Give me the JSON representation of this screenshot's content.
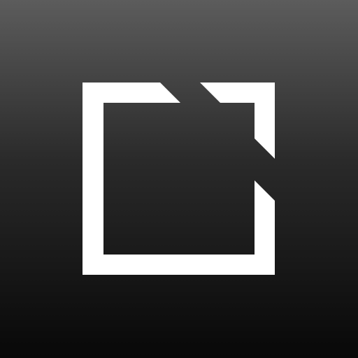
{
  "app_icon": {
    "name": "square-logo-icon",
    "colors": {
      "background_top": "#5c5c5c",
      "background_middle": "#2a2a2a",
      "background_bottom": "#080808",
      "logo": "#ffffff"
    }
  }
}
